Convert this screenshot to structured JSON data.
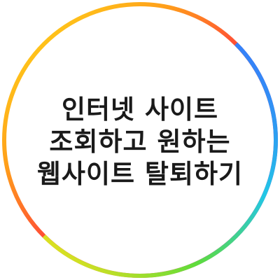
{
  "title": {
    "lines": [
      "인터넷 사이트",
      "조회하고 원하는",
      "웹사이트 탈퇴하기"
    ]
  },
  "ring": {
    "gradient_colors": [
      "#ff3b3b",
      "#ff9f1a",
      "#ffe11a",
      "#5fdc3a",
      "#22c7e6",
      "#3b6cff",
      "#9b3bff",
      "#ff3bb4"
    ]
  }
}
